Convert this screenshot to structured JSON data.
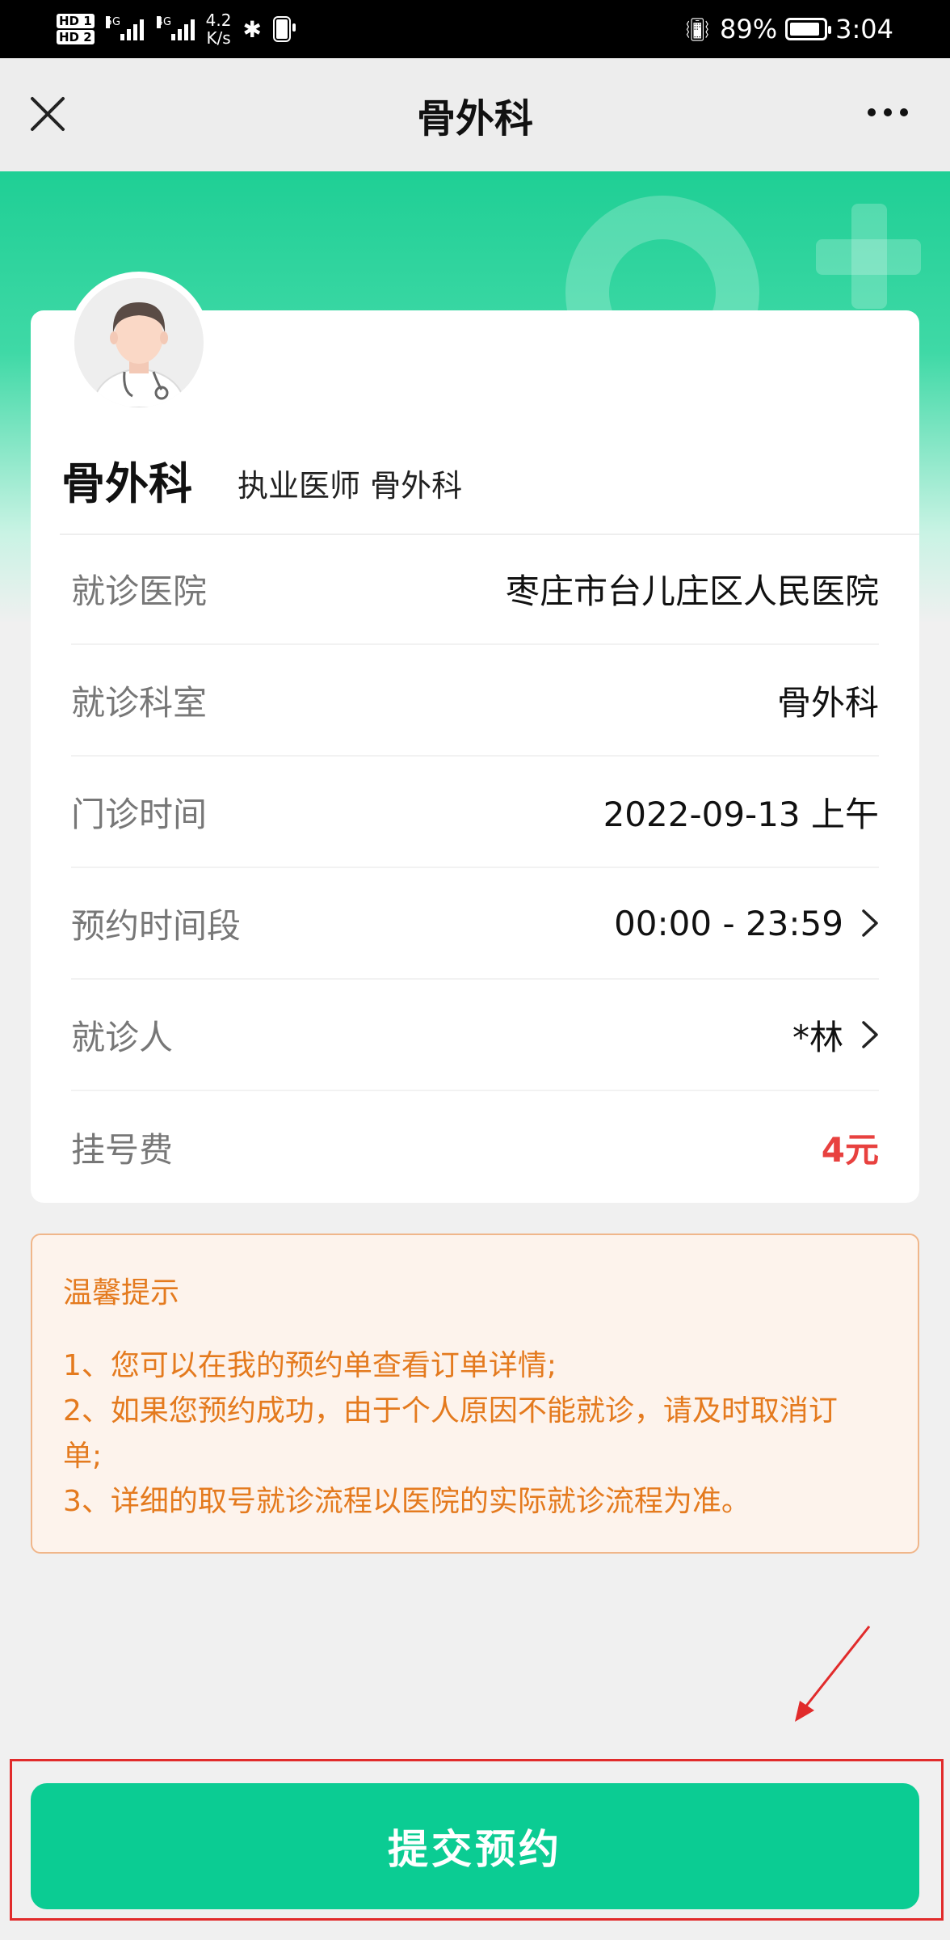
{
  "status_bar": {
    "hd1": "HD 1",
    "hd2": "HD 2",
    "net1": "5G",
    "net2": "4G",
    "speed_value": "4.2",
    "speed_unit": "K/s",
    "battery_percent": "89%",
    "battery_level": 0.89,
    "time": "3:04",
    "icons": [
      "bluetooth-icon",
      "vibrate-icon",
      "battery-icon",
      "signal-icon"
    ]
  },
  "nav": {
    "title": "骨外科",
    "icons": [
      "close-icon",
      "more-icon"
    ]
  },
  "doctor": {
    "name": "骨外科",
    "title": "执业医师 骨外科"
  },
  "info_rows": [
    {
      "label": "就诊医院",
      "value": "枣庄市台儿庄区人民医院"
    },
    {
      "label": "就诊科室",
      "value": "骨外科"
    },
    {
      "label": "门诊时间",
      "value": "2022-09-13 上午"
    },
    {
      "label": "预约时间段",
      "value": "00:00 - 23:59"
    },
    {
      "label": "就诊人",
      "value": "*林"
    },
    {
      "label": "挂号费",
      "value": "4元"
    }
  ],
  "tips": {
    "title": "温馨提示",
    "lines": [
      "1、您可以在我的预约单查看订单详情;",
      "2、如果您预约成功，由于个人原因不能就诊，请及时取消订",
      "单;",
      "3、详细的取号就诊流程以医院的实际就诊流程为准。"
    ]
  },
  "submit_label": "提交预约",
  "colors": {
    "accent": "#0bcc93",
    "fee": "#e8413f",
    "tips_text": "#e47a1e",
    "tips_bg": "#fdf3ec",
    "annotation": "#e12b2b"
  }
}
